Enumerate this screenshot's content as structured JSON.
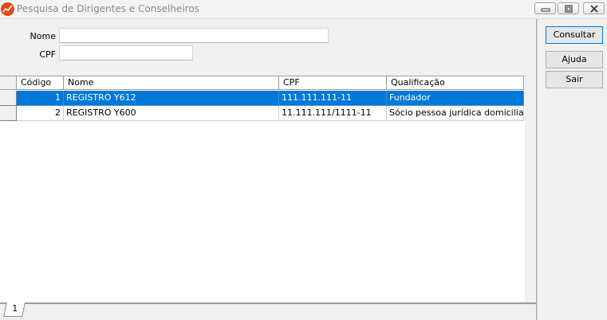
{
  "window": {
    "title": "Pesquisa de Dirigentes e Conselheiros",
    "icon": "app-logo-icon",
    "controls": [
      "minimize-icon",
      "restore-icon",
      "close-icon"
    ]
  },
  "form": {
    "nome_label": "Nome",
    "nome_value": "",
    "cpf_label": "CPF",
    "cpf_value": ""
  },
  "grid": {
    "columns": [
      "Código",
      "Nome",
      "CPF",
      "Qualificação"
    ],
    "rows": [
      {
        "codigo": "1",
        "nome": "REGISTRO Y612",
        "cpf": "111.111.111-11",
        "qualificacao": "Fundador",
        "selected": true
      },
      {
        "codigo": "2",
        "nome": "REGISTRO Y600",
        "cpf": "11.111.111/1111-11",
        "qualificacao": "Sócio pessoa jurídica domiciliado no",
        "selected": false
      }
    ],
    "selected_color": "#0078d7"
  },
  "tabs": [
    "1"
  ],
  "buttons": {
    "consultar": "Consultar",
    "ajuda": "Ajuda",
    "sair": "Sair"
  }
}
